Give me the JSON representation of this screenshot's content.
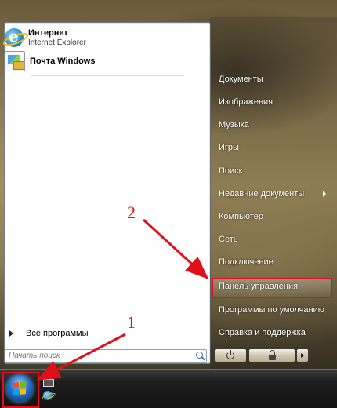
{
  "start_menu": {
    "pinned": [
      {
        "title": "Интернет",
        "subtitle": "Internet Explorer",
        "icon": "internet-explorer-icon"
      },
      {
        "title": "Почта Windows",
        "icon": "windows-mail-icon"
      }
    ],
    "all_programs_label": "Все программы",
    "search": {
      "placeholder": "Начать поиск",
      "icon": "search-icon"
    },
    "right_items": [
      {
        "label": "Документы"
      },
      {
        "label": "Изображения"
      },
      {
        "label": "Музыка"
      },
      {
        "label": "Игры"
      },
      {
        "label": "Поиск"
      },
      {
        "label": "Недавние документы",
        "has_submenu": true
      },
      {
        "label": "Компьютер"
      },
      {
        "label": "Сеть"
      },
      {
        "label": "Подключение"
      },
      {
        "label": "Панель управления",
        "highlighted": true
      },
      {
        "label": "Программы по умолчанию"
      },
      {
        "label": "Справка и поддержка"
      }
    ],
    "power_buttons": [
      {
        "icon": "power-icon"
      },
      {
        "icon": "lock-icon"
      },
      {
        "icon": "arrow-right-icon"
      }
    ]
  },
  "taskbar": {
    "start_button_icon": "windows-logo-icon",
    "quick_launch": [
      "show-desktop-icon",
      "internet-explorer-icon"
    ]
  },
  "annotations": {
    "marker_1": "1",
    "marker_2": "2",
    "color": "#e0101a"
  }
}
